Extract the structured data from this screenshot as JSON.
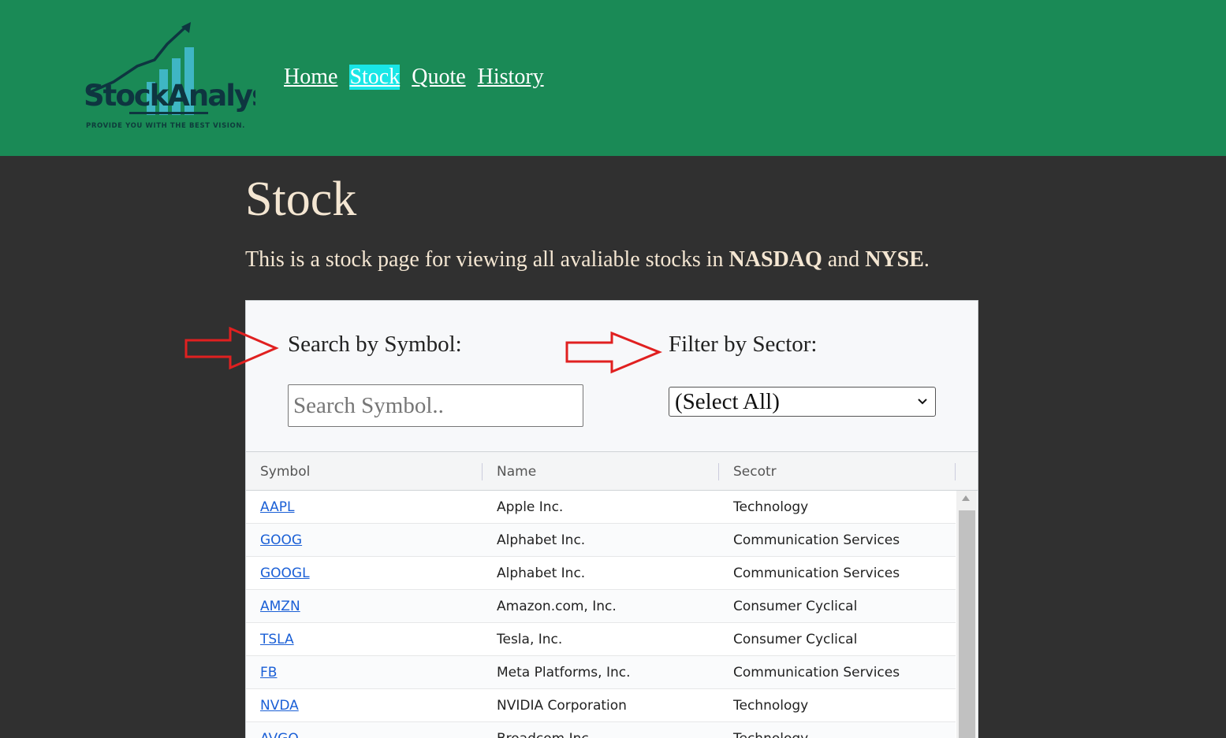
{
  "header": {
    "logo_text": "StockAnalyst",
    "logo_tagline": "PROVIDE YOU WITH THE BEST VISION.",
    "nav": [
      {
        "label": "Home",
        "active": false
      },
      {
        "label": "Stock",
        "active": true
      },
      {
        "label": "Quote",
        "active": false
      },
      {
        "label": "History",
        "active": false
      }
    ]
  },
  "main": {
    "title": "Stock",
    "intro_prefix": "This is a stock page for viewing all avaliable stocks in ",
    "intro_bold_1": "NASDAQ",
    "intro_mid": " and ",
    "intro_bold_2": "NYSE",
    "intro_suffix": "."
  },
  "filters": {
    "search_label": "Search by Symbol:",
    "search_placeholder": "Search Symbol..",
    "search_value": "",
    "sector_label": "Filter by Sector:",
    "sector_selected": "(Select All)"
  },
  "table": {
    "columns": [
      "Symbol",
      "Name",
      "Secotr"
    ],
    "rows": [
      {
        "symbol": "AAPL",
        "name": "Apple Inc.",
        "sector": "Technology"
      },
      {
        "symbol": "GOOG",
        "name": "Alphabet Inc.",
        "sector": "Communication Services"
      },
      {
        "symbol": "GOOGL",
        "name": "Alphabet Inc.",
        "sector": "Communication Services"
      },
      {
        "symbol": "AMZN",
        "name": "Amazon.com, Inc.",
        "sector": "Consumer Cyclical"
      },
      {
        "symbol": "TSLA",
        "name": "Tesla, Inc.",
        "sector": "Consumer Cyclical"
      },
      {
        "symbol": "FB",
        "name": "Meta Platforms, Inc.",
        "sector": "Communication Services"
      },
      {
        "symbol": "NVDA",
        "name": "NVIDIA Corporation",
        "sector": "Technology"
      },
      {
        "symbol": "AVGO",
        "name": "Broadcom Inc.",
        "sector": "Technology"
      }
    ]
  },
  "colors": {
    "header_bg": "#1a8a56",
    "page_bg": "#303030",
    "nav_active_bg": "#19e6e6",
    "title_text": "#f4e6d2",
    "annotation_arrow": "#e02020",
    "link": "#1a5fd6"
  }
}
